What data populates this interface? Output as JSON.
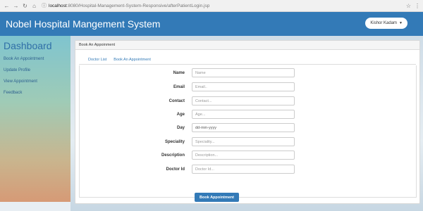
{
  "browser": {
    "host": "localhost",
    "path": ":8080/Hospital-Management-System-Responsive/afterPatientLogin.jsp"
  },
  "header": {
    "title": "Nobel Hospital Mangement System",
    "user_name": "Kishor Kadam"
  },
  "sidebar": {
    "title": "Dashboard",
    "items": [
      {
        "label": "Book An Appointment"
      },
      {
        "label": "Update Profile"
      },
      {
        "label": "View Appointment"
      },
      {
        "label": "Feedback"
      }
    ]
  },
  "panel": {
    "heading": "Book An Appoinment",
    "tabs": [
      {
        "label": "Doctor List"
      },
      {
        "label": "Book An Appointment"
      }
    ]
  },
  "form": {
    "fields": [
      {
        "label": "Name",
        "placeholder": "Name"
      },
      {
        "label": "Email",
        "placeholder": "Email.."
      },
      {
        "label": "Contact",
        "placeholder": "Contact..."
      },
      {
        "label": "Age",
        "placeholder": "Age..."
      },
      {
        "label": "Day",
        "value": "dd-mm-yyyy"
      },
      {
        "label": "Speciality",
        "placeholder": "Speciality..."
      },
      {
        "label": "Description",
        "placeholder": "Description..."
      },
      {
        "label": "Doctor Id",
        "placeholder": "Doctor Id..."
      }
    ],
    "submit_label": "Book Appointment"
  },
  "colors": {
    "header_bg": "#337ab7",
    "button_bg": "#337ab7",
    "sidebar_link": "#2d5f8e"
  }
}
